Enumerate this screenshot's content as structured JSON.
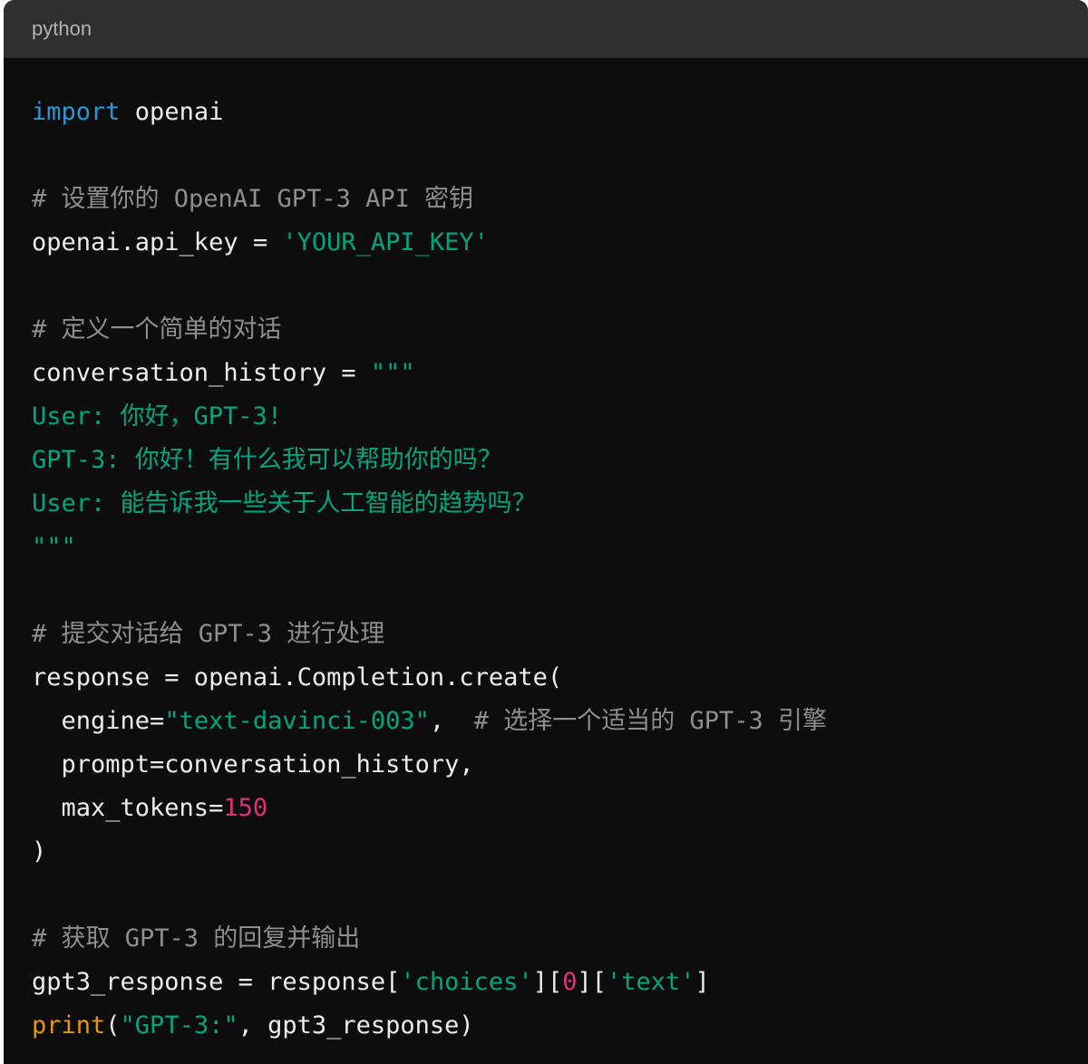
{
  "header": {
    "language": "python"
  },
  "code": {
    "lines": [
      [
        {
          "t": "kw",
          "v": "import"
        },
        {
          "t": "plain",
          "v": " openai"
        }
      ],
      [],
      [
        {
          "t": "com",
          "v": "# 设置你的 OpenAI GPT-3 API 密钥"
        }
      ],
      [
        {
          "t": "plain",
          "v": "openai.api_key = "
        },
        {
          "t": "str",
          "v": "'YOUR_API_KEY'"
        }
      ],
      [],
      [
        {
          "t": "com",
          "v": "# 定义一个简单的对话"
        }
      ],
      [
        {
          "t": "plain",
          "v": "conversation_history = "
        },
        {
          "t": "str",
          "v": "\"\"\""
        }
      ],
      [
        {
          "t": "str",
          "v": "User: 你好，GPT-3!"
        }
      ],
      [
        {
          "t": "str",
          "v": "GPT-3: 你好！有什么我可以帮助你的吗？"
        }
      ],
      [
        {
          "t": "str",
          "v": "User: 能告诉我一些关于人工智能的趋势吗？"
        }
      ],
      [
        {
          "t": "str",
          "v": "\"\"\""
        }
      ],
      [],
      [
        {
          "t": "com",
          "v": "# 提交对话给 GPT-3 进行处理"
        }
      ],
      [
        {
          "t": "plain",
          "v": "response = openai.Completion.create("
        }
      ],
      [
        {
          "t": "plain",
          "v": "  engine="
        },
        {
          "t": "str",
          "v": "\"text-davinci-003\""
        },
        {
          "t": "plain",
          "v": ",  "
        },
        {
          "t": "com",
          "v": "# 选择一个适当的 GPT-3 引擎"
        }
      ],
      [
        {
          "t": "plain",
          "v": "  prompt=conversation_history,"
        }
      ],
      [
        {
          "t": "plain",
          "v": "  max_tokens="
        },
        {
          "t": "num",
          "v": "150"
        }
      ],
      [
        {
          "t": "plain",
          "v": ")"
        }
      ],
      [],
      [
        {
          "t": "com",
          "v": "# 获取 GPT-3 的回复并输出"
        }
      ],
      [
        {
          "t": "plain",
          "v": "gpt3_response = response["
        },
        {
          "t": "str",
          "v": "'choices'"
        },
        {
          "t": "plain",
          "v": "]["
        },
        {
          "t": "num",
          "v": "0"
        },
        {
          "t": "plain",
          "v": "]["
        },
        {
          "t": "str",
          "v": "'text'"
        },
        {
          "t": "plain",
          "v": "]"
        }
      ],
      [
        {
          "t": "fn",
          "v": "print"
        },
        {
          "t": "plain",
          "v": "("
        },
        {
          "t": "str",
          "v": "\"GPT-3:\""
        },
        {
          "t": "plain",
          "v": ", gpt3_response)"
        }
      ]
    ]
  }
}
